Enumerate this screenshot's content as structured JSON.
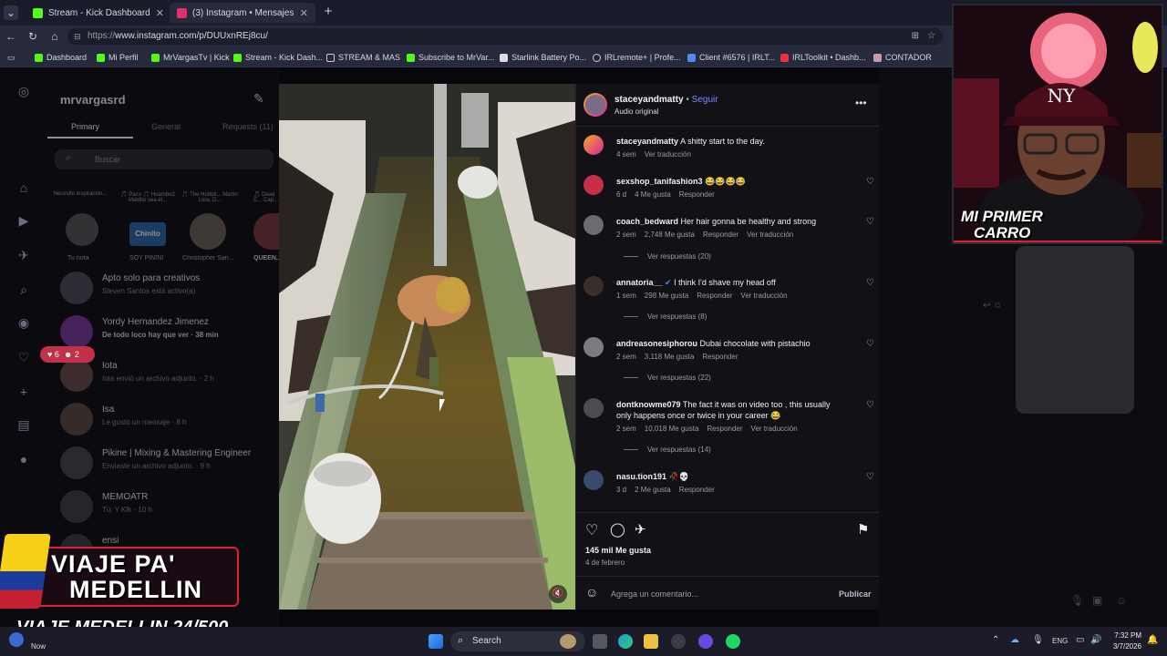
{
  "browser": {
    "tabs": [
      {
        "title": "Stream - Kick Dashboard",
        "active": false,
        "color": "#53fc18"
      },
      {
        "title": "(3) Instagram • Mensajes",
        "active": true,
        "color": "#e1306c"
      }
    ],
    "url_prefix": "https://",
    "url_host": "www.instagram.com",
    "url_path": "/p/DUUxnREj8cu/",
    "bookmarks": [
      "Dashboard",
      "Mi Perfil",
      "MrVargasTv | Kick",
      "Stream - Kick Dash...",
      "STREAM & MAS",
      "Subscribe to MrVar...",
      "Starlink Battery Po...",
      "IRLremote+ | Profe...",
      "Client #6576 | IRLT...",
      "IRLToolkit • Dashb...",
      "CONTADOR"
    ]
  },
  "dm_panel": {
    "username": "mrvargasrd",
    "tabs": [
      "Primary",
      "General",
      "Requests (11)"
    ],
    "search_placeholder": "Buscar",
    "stories": [
      {
        "note": "Necesito inspiración...",
        "name": "Tu nota"
      },
      {
        "note": "🎵 Paco 🎵 Huambo2 Maldito sea el...",
        "name": "SOY PININI"
      },
      {
        "note": "🎵 The Hobbit... Martin Lora, D...",
        "name": "Christopher San..."
      },
      {
        "note": "🎵 Dead C... Cap...",
        "name": "QUEEN..."
      }
    ],
    "threads": [
      {
        "name": "Apto solo para creativos",
        "sub": "Steven Santos está activo(a)"
      },
      {
        "name": "Yordy Hernandez Jimenez",
        "sub": "De todo loco hay que ver · 38 min"
      },
      {
        "name": "Iota",
        "sub": "Iota envió un archivo adjunto. · 2 h"
      },
      {
        "name": "Isa",
        "sub": "Le gustó un mensaje · 8 h"
      },
      {
        "name": "Pikine | Mixing & Mastering Engineer",
        "sub": "Enviaste un archivo adjunto. · 9 h"
      },
      {
        "name": "MEMOATR",
        "sub": "Tú: Y Klk · 10 h"
      },
      {
        "name": "ensi",
        "sub": ""
      }
    ],
    "notif_badge": {
      "likes": "6",
      "follows": "2"
    }
  },
  "post": {
    "author": "staceyandmatty",
    "follow_label": "Seguir",
    "audio": "Audio original",
    "caption": {
      "user": "staceyandmatty",
      "text": "A shitty start to the day.",
      "time": "4 sem",
      "translate": "Ver traducción"
    },
    "comments": [
      {
        "user": "sexshop_tanifashion3",
        "text": "😂😂😂😂",
        "time": "6 d",
        "likes": "4 Me gusta",
        "reply": "Responder",
        "translate": "",
        "replies": ""
      },
      {
        "user": "coach_bedward",
        "text": "Her hair gonna be healthy and strong",
        "time": "2 sem",
        "likes": "2,748 Me gusta",
        "reply": "Responder",
        "translate": "Ver traducción",
        "replies": "Ver respuestas (20)"
      },
      {
        "user": "annatoria__",
        "text": "I think I'd shave my head off",
        "time": "1 sem",
        "likes": "298 Me gusta",
        "reply": "Responder",
        "translate": "Ver traducción",
        "replies": "Ver respuestas (8)",
        "verified": true
      },
      {
        "user": "andreasonesiphorou",
        "text": "Dubai chocolate with pistachio",
        "time": "2 sem",
        "likes": "3,118 Me gusta",
        "reply": "Responder",
        "translate": "",
        "replies": "Ver respuestas (22)"
      },
      {
        "user": "dontknowme079",
        "text": "The fact it was on video too , this usually only happens once or twice in your career 😂",
        "time": "2 sem",
        "likes": "10,018 Me gusta",
        "reply": "Responder",
        "translate": "Ver traducción",
        "replies": "Ver respuestas (14)"
      },
      {
        "user": "nasu.tion191",
        "text": "🥀💀",
        "time": "3 d",
        "likes": "2 Me gusta",
        "reply": "Responder",
        "translate": "",
        "replies": ""
      }
    ],
    "likes_total": "145 mil Me gusta",
    "date": "4 de febrero",
    "add_comment_placeholder": "Agrega un comentario...",
    "publish_label": "Publicar"
  },
  "overlays": {
    "cam_text_line1": "MI PRIMER",
    "cam_text_line2": "CARRO",
    "banner_line1": "VIAJE PA'",
    "banner_line2": "MEDELLIN",
    "goal_text": "VIAJE MEDELLIN 24/500",
    "now_label": "Now"
  },
  "taskbar": {
    "search_label": "Search",
    "lang": "ENG",
    "time": "7:32 PM",
    "date": "3/7/2026"
  },
  "colors": {
    "accent_blue": "#4a5df9",
    "kick_green": "#53fc18",
    "ig_pink": "#e1306c"
  }
}
